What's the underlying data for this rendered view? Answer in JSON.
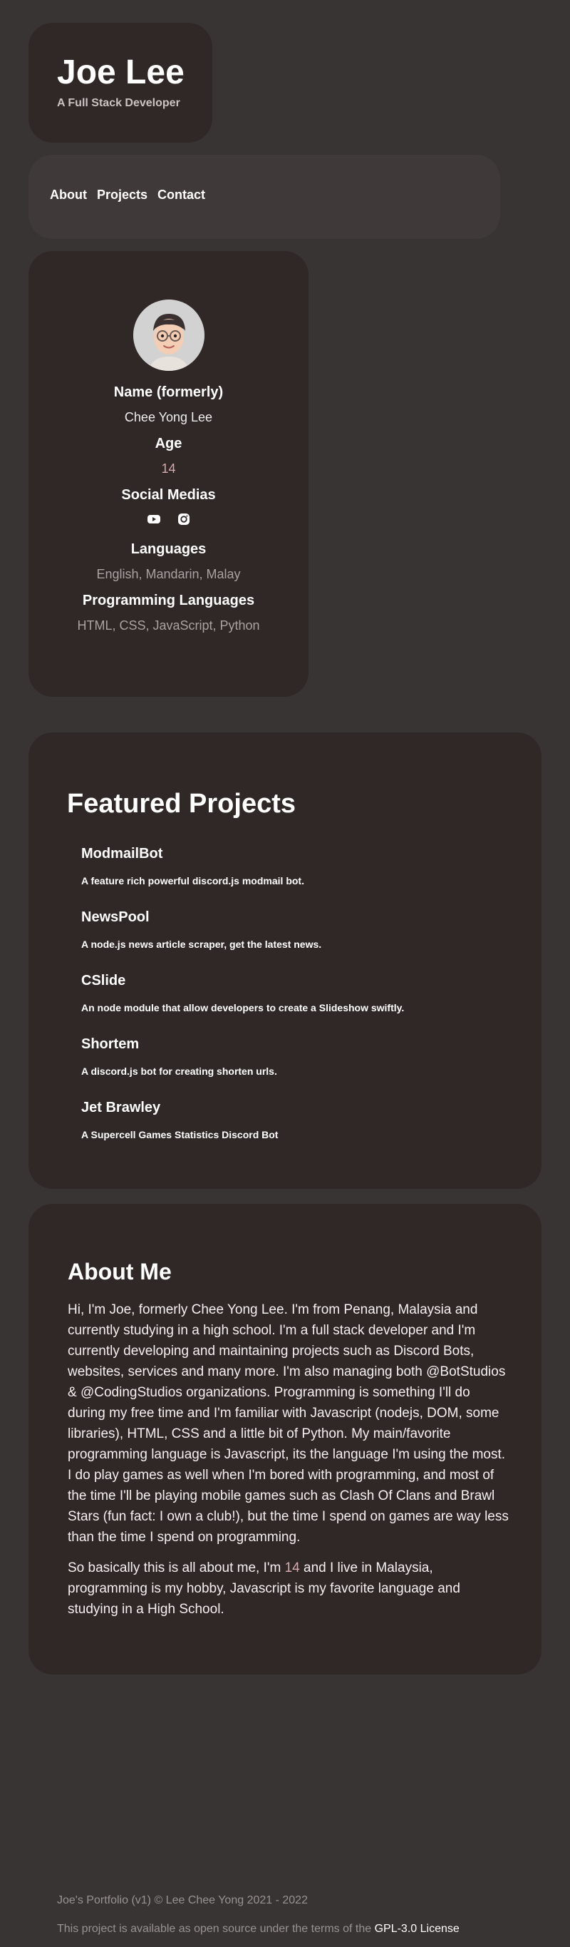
{
  "header": {
    "name": "Joe Lee",
    "subtitle": "A Full Stack Developer"
  },
  "nav": {
    "items": [
      {
        "label": "About"
      },
      {
        "label": "Projects"
      },
      {
        "label": "Contact"
      }
    ]
  },
  "profile": {
    "name_heading": "Name (formerly)",
    "name_value": "Chee Yong Lee",
    "age_heading": "Age",
    "age_value": "14",
    "social_heading": "Social Medias",
    "social_icons": [
      "youtube-icon",
      "instagram-icon"
    ],
    "languages_heading": "Languages",
    "languages_value": "English, Mandarin, Malay",
    "prog_heading": "Programming Languages",
    "prog_value": "HTML, CSS, JavaScript, Python"
  },
  "projects": {
    "title": "Featured Projects",
    "items": [
      {
        "name": "ModmailBot",
        "desc": "A feature rich powerful discord.js modmail bot."
      },
      {
        "name": "NewsPool",
        "desc": "A node.js news article scraper, get the latest news."
      },
      {
        "name": "CSlide",
        "desc": "An node module that allow developers to create a Slideshow swiftly."
      },
      {
        "name": "Shortem",
        "desc": "A discord.js bot for creating shorten urls."
      },
      {
        "name": "Jet Brawley",
        "desc": "A Supercell Games Statistics Discord Bot"
      }
    ]
  },
  "about": {
    "title": "About Me",
    "paragraph1": "Hi, I'm Joe, formerly Chee Yong Lee. I'm from Penang, Malaysia and currently studying in a high school. I'm a full stack developer and I'm currently developing and maintaining projects such as Discord Bots, websites, services and many more. I'm also managing both @BotStudios & @CodingStudios organizations. Programming is something I'll do during my free time and I'm familiar with Javascript (nodejs, DOM, some libraries), HTML, CSS and a little bit of Python. My main/favorite programming language is Javascript, its the language I'm using the most. I do play games as well when I'm bored with programming, and most of the time I'll be playing mobile games such as Clash Of Clans and Brawl Stars (fun fact: I own a club!), but the time I spend on games are way less than the time I spend on programming.",
    "paragraph2_pre": "So basically this is all about me, I'm ",
    "paragraph2_age": "14",
    "paragraph2_post": " and I live in Malaysia, programming is my hobby, Javascript is my favorite language and studying in a High School."
  },
  "footer": {
    "line1": "Joe's Portfolio (v1) © Lee Chee Yong 2021 - 2022",
    "line2_text": "This project is available as open source under the terms of the ",
    "license_link": "GPL-3.0 License"
  },
  "colors": {
    "background": "#383433",
    "card": "#302827",
    "nav_card": "#3f3a39",
    "accent_age": "#d8aaaa"
  }
}
